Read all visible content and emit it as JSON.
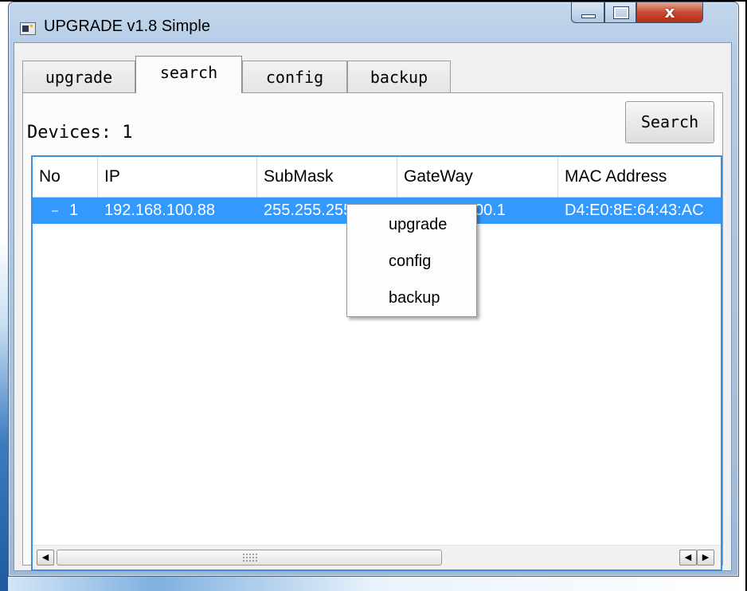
{
  "window": {
    "title": "UPGRADE v1.8 Simple",
    "close_glyph": "x",
    "accent": "#3399ff"
  },
  "tabs": [
    {
      "label": "upgrade",
      "active": false
    },
    {
      "label": "search",
      "active": true
    },
    {
      "label": "config",
      "active": false
    },
    {
      "label": "backup",
      "active": false
    }
  ],
  "search": {
    "devices_label": "Devices: 1",
    "button_label": "Search"
  },
  "table": {
    "headers": [
      "No",
      "IP",
      "SubMask",
      "GateWay",
      "MAC Address"
    ],
    "rows": [
      {
        "no": "1",
        "ip": "192.168.100.88",
        "submask": "255.255.255.0",
        "gateway": "192.168.100.1",
        "mac": "D4:E0:8E:64:43:AC",
        "selected": true
      }
    ]
  },
  "context_menu": {
    "items": [
      "upgrade",
      "config",
      "backup"
    ]
  },
  "scrollbar": {
    "left_arrow": "◀",
    "right_arrow": "▶"
  }
}
